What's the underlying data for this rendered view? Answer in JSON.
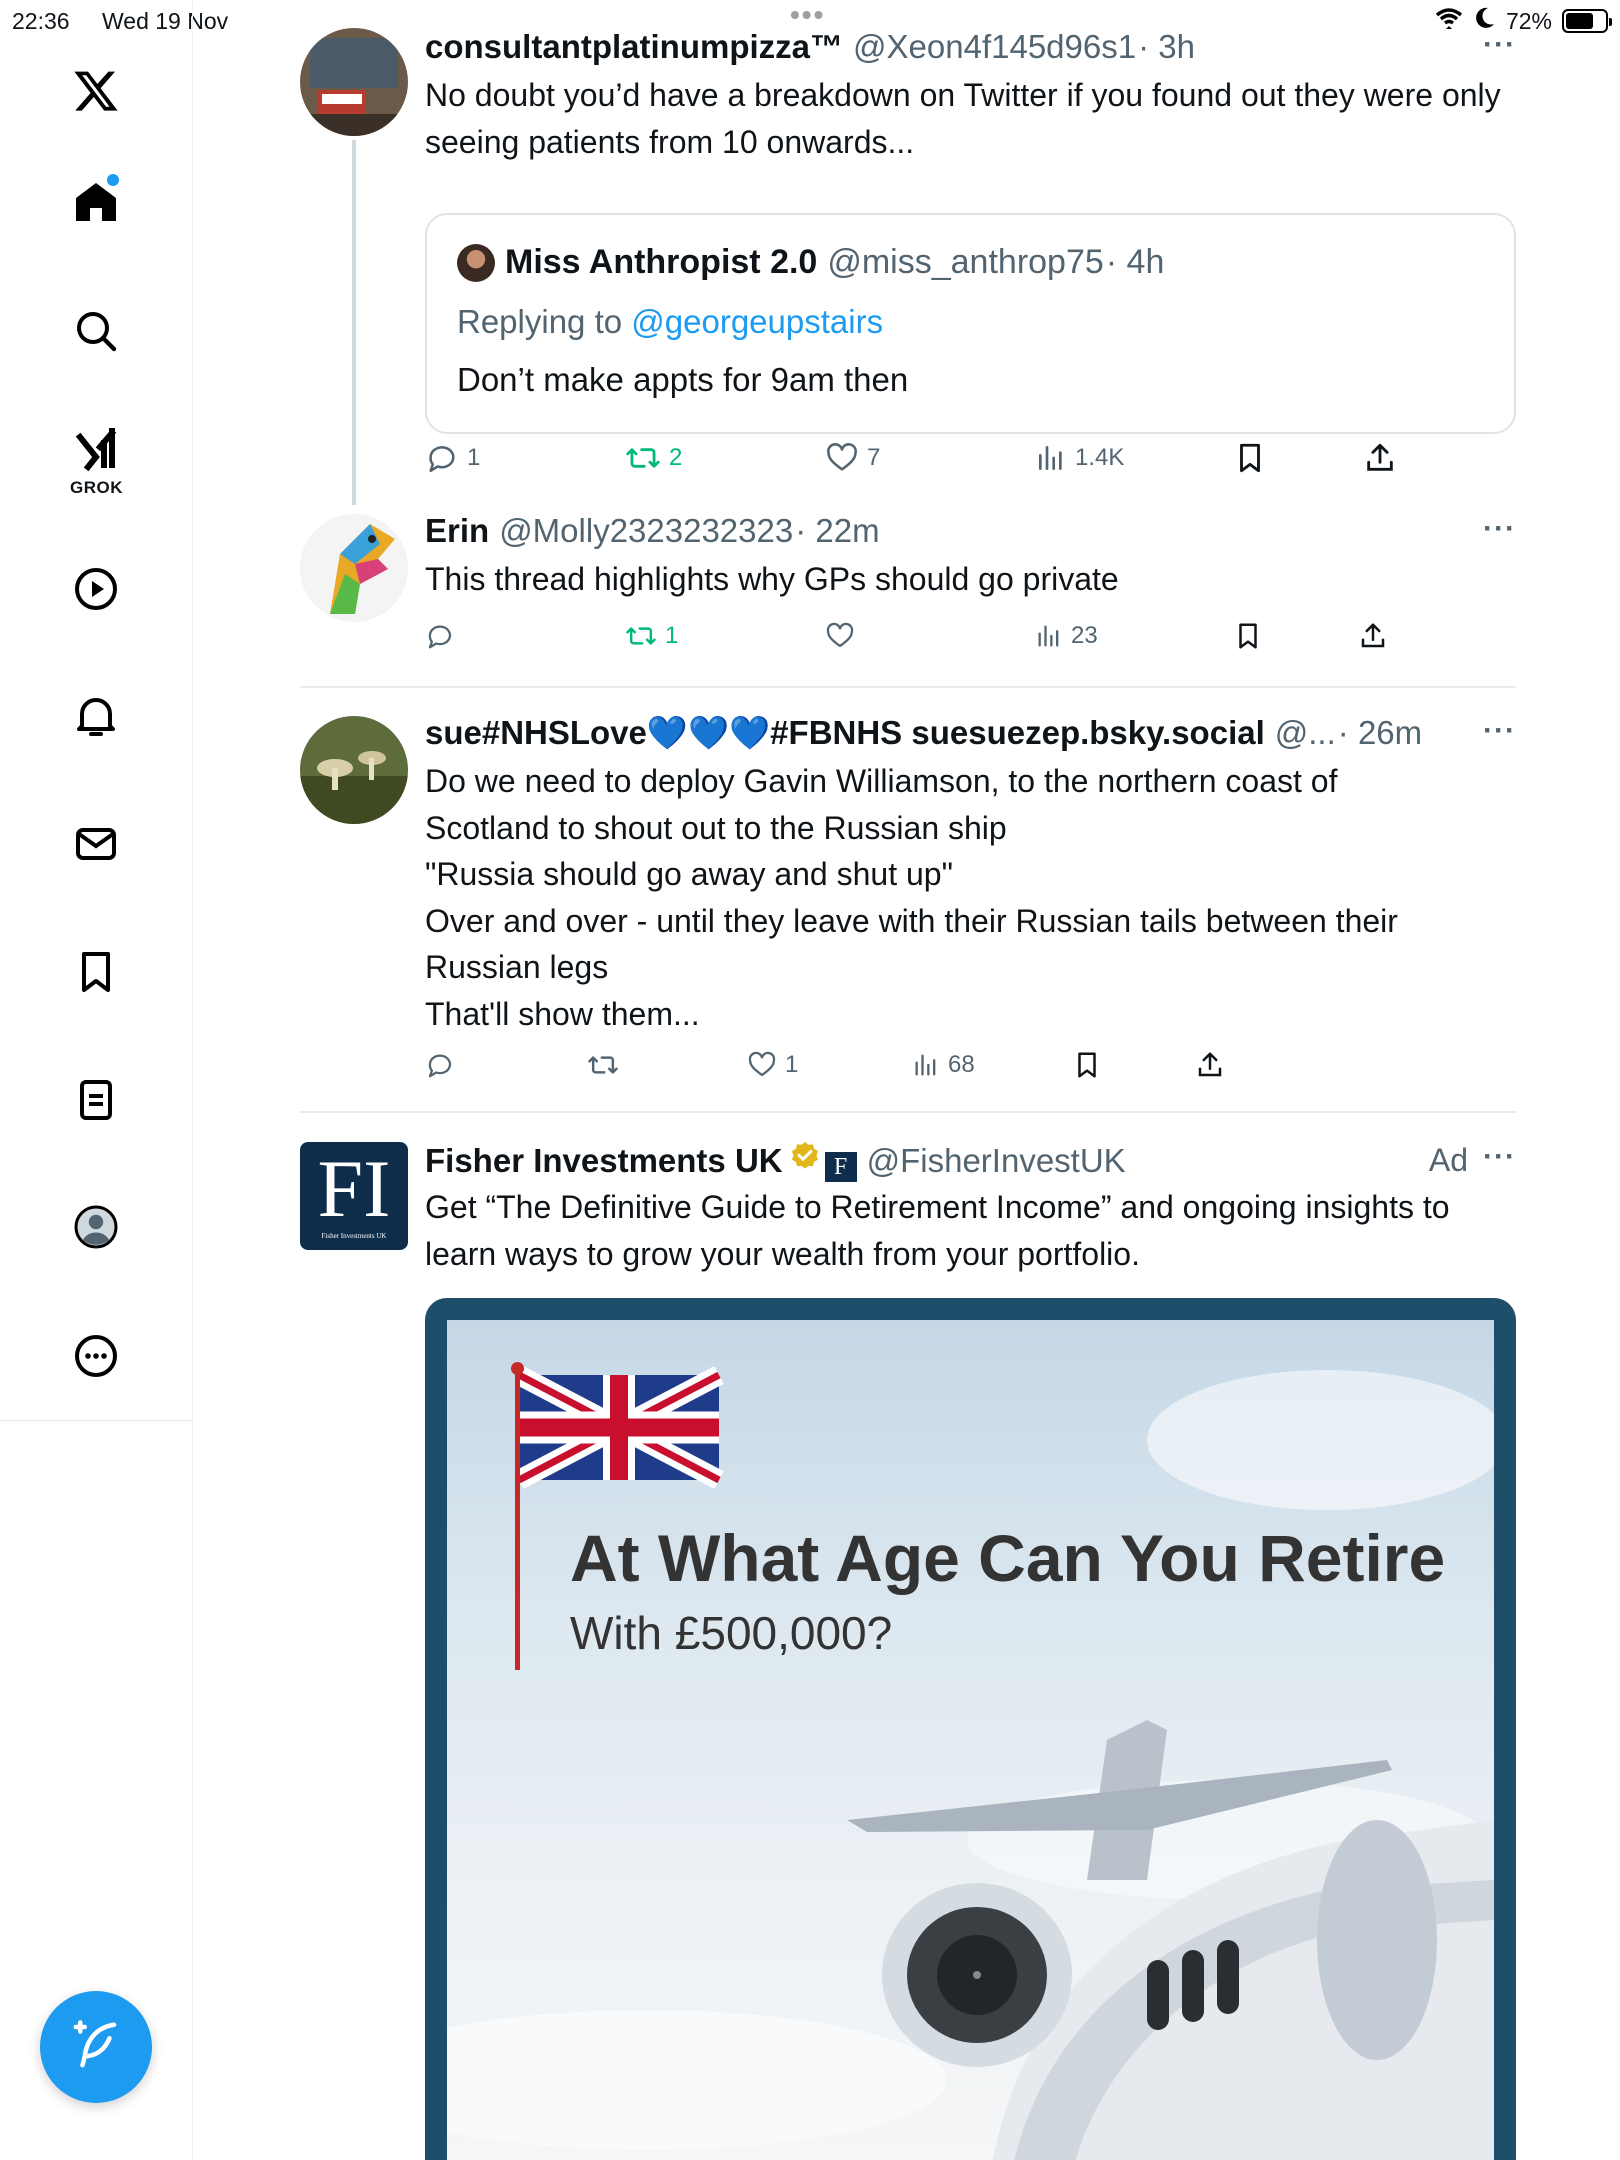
{
  "status_bar": {
    "time": "22:36",
    "date": "Wed 19 Nov",
    "battery": "72%",
    "battery_level": 0.72
  },
  "sidebar": {
    "logo": "x-logo-icon",
    "items": [
      {
        "name": "home",
        "icon": "home-icon",
        "has_notification_dot": true
      },
      {
        "name": "explore",
        "icon": "search-icon"
      },
      {
        "name": "grok",
        "icon": "grok-icon",
        "label": "GROK"
      },
      {
        "name": "video",
        "icon": "play-icon"
      },
      {
        "name": "notifications",
        "icon": "bell-icon"
      },
      {
        "name": "messages",
        "icon": "mail-icon"
      },
      {
        "name": "bookmarks",
        "icon": "bookmark-icon"
      },
      {
        "name": "lists",
        "icon": "list-icon"
      },
      {
        "name": "profile",
        "icon": "profile-icon"
      },
      {
        "name": "more",
        "icon": "more-icon"
      }
    ],
    "compose_icon": "compose-icon"
  },
  "posts": [
    {
      "name": "consultantplatinumpizza™",
      "handle": "@Xeon4f145d96s1",
      "time": "· 3h",
      "text": "No doubt you’d have a breakdown on Twitter if you found out they were only seeing patients from 10 onwards...",
      "quote": {
        "name": "Miss Anthropist 2.0",
        "handle": "@miss_anthrop75",
        "time": "· 4h",
        "replying_prefix": "Replying to ",
        "replying_to": "@georgeupstairs",
        "text": "Don’t make appts for 9am then"
      },
      "replies": "1",
      "reposts": "2",
      "likes": "7",
      "views": "1.4K"
    },
    {
      "name": "Erin",
      "handle": "@Molly2323232323",
      "time": "· 22m",
      "text": "This thread highlights why GPs should go private",
      "replies": "",
      "reposts": "1",
      "likes": "",
      "views": "23"
    },
    {
      "name": "sue#NHSLove💙💙💙#FBNHS suesuezep.bsky.social",
      "handle": "@...",
      "time": "· 26m",
      "text_lines": [
        "Do we need to deploy Gavin Williamson, to the northern coast of",
        "Scotland to shout out to the Russian ship",
        "\"Russia should go away and shut up\"",
        "Over and over - until they leave with their Russian tails between their",
        "Russian legs",
        "That'll show them..."
      ],
      "replies": "",
      "reposts": "",
      "likes": "1",
      "views": "68"
    },
    {
      "name": "Fisher Investments UK",
      "handle": "@FisherInvestUK",
      "ad_label": "Ad",
      "text": "Get “The Definitive Guide to Retirement Income” and ongoing insights to learn ways to grow your wealth from your portfolio.",
      "avatar_text": "FI",
      "avatar_subtext": "Fisher Investments UK",
      "ad_image": {
        "title": "At What Age Can You Retire",
        "subtitle": "With £500,000?"
      }
    }
  ],
  "colors": {
    "accent": "#1d9bf0",
    "repost_green": "#00ba7c",
    "secondary_text": "#536471",
    "ad_border": "#1f4e6b"
  }
}
